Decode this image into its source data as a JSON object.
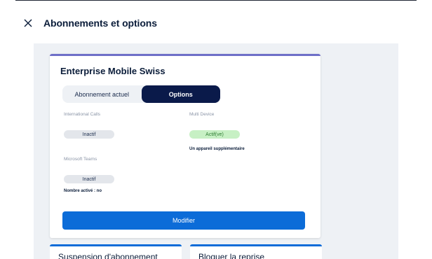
{
  "header": {
    "title": "Abonnements et options",
    "close_icon": "close-icon"
  },
  "card": {
    "title": "Enterprise Mobile Swiss",
    "tabs": [
      {
        "label": "Abonnement actuel",
        "active": false
      },
      {
        "label": "Options",
        "active": true
      }
    ],
    "options": {
      "international_calls": {
        "label": "International Calls",
        "status": "Inactif"
      },
      "microsoft_teams": {
        "label": "Microsoft Teams",
        "status": "Inactif",
        "note": "Nombre activé : no"
      },
      "multi_device": {
        "label": "Multi Device",
        "status": "Actif(ve)",
        "note": "Un appareil supplémentaire"
      }
    },
    "button_label": "Modifier"
  },
  "subcards": [
    {
      "title": "Suspension d'abonnement"
    },
    {
      "title": "Bloquer la reprise"
    }
  ],
  "colors": {
    "accent_primary": "#0c6cd8",
    "tab_active": "#0a1a4a",
    "card_border": "#6e6fc8",
    "active_badge": "#c7f0c4",
    "inactive_badge": "#e3e6eb",
    "backdrop": "#eef1f5"
  }
}
